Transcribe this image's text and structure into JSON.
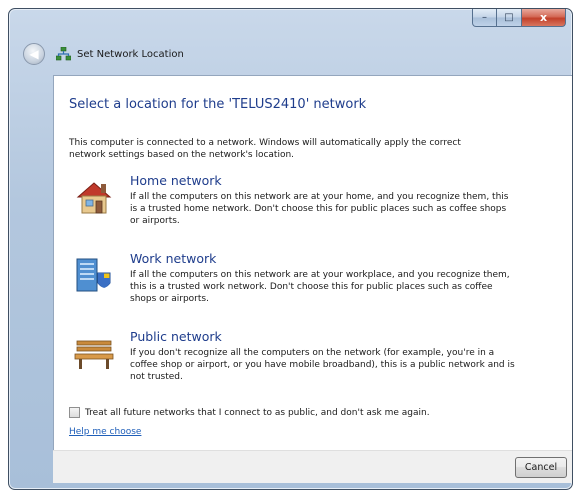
{
  "window": {
    "title": "Set Network Location",
    "caption_buttons": {
      "minimize": "–",
      "maximize": "□",
      "close": "x"
    },
    "back_icon": "back-arrow-icon"
  },
  "content": {
    "heading": "Select a location for the 'TELUS2410' network",
    "intro": "This computer is connected to a network. Windows will automatically apply the correct network settings based on the network's location.",
    "options": [
      {
        "title": "Home network",
        "description": "If all the computers on this network are at your home, and you recognize them, this is a trusted home network.  Don't choose this for public places such as coffee shops or airports.",
        "icon": "house-icon"
      },
      {
        "title": "Work network",
        "description": "If all the computers on this network are at your workplace, and you recognize them, this is a trusted work network.  Don't choose this for public places such as coffee shops or airports.",
        "icon": "office-building-icon"
      },
      {
        "title": "Public network",
        "description": "If you don't recognize all the computers on the network (for example, you're in a coffee shop or airport, or you have mobile broadband), this is a public network and is not trusted.",
        "icon": "park-bench-icon"
      }
    ],
    "checkbox": {
      "label": "Treat all future networks that I connect to as public, and don't ask me again.",
      "checked": false
    },
    "help_link": "Help me choose"
  },
  "footer": {
    "cancel_label": "Cancel"
  },
  "colors": {
    "heading": "#1f3d8c",
    "link": "#1f5fb9",
    "frame": "#b3c7de"
  }
}
